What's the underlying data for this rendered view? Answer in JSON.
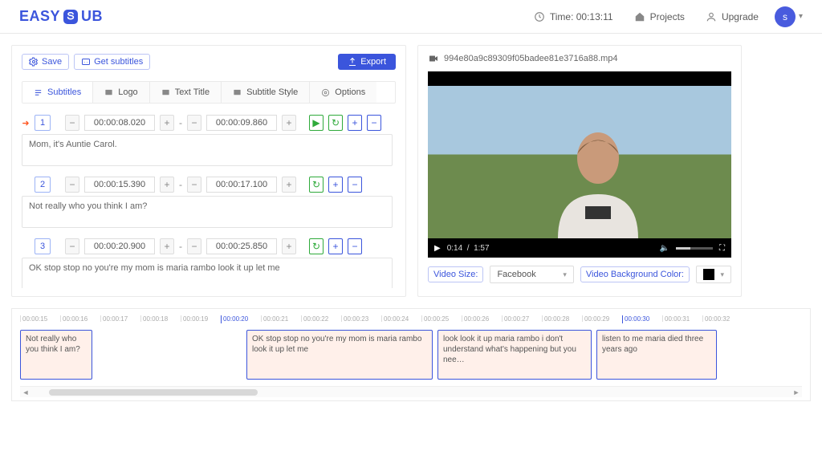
{
  "header": {
    "logo_prefix": "EASY",
    "logo_suffix": "UB",
    "time_label": "Time:",
    "time_value": "00:13:11",
    "projects": "Projects",
    "upgrade": "Upgrade",
    "avatar_letter": "s"
  },
  "toolbar": {
    "save": "Save",
    "get_subtitles": "Get subtitles",
    "export": "Export"
  },
  "tabs": {
    "subtitles": "Subtitles",
    "logo": "Logo",
    "text_title": "Text Title",
    "subtitle_style": "Subtitle Style",
    "options": "Options"
  },
  "subs": [
    {
      "n": "1",
      "start": "00:00:08.020",
      "end": "00:00:09.860",
      "text": "Mom, it's Auntie Carol.",
      "current": true
    },
    {
      "n": "2",
      "start": "00:00:15.390",
      "end": "00:00:17.100",
      "text": "Not really who you think I am?",
      "current": false
    },
    {
      "n": "3",
      "start": "00:00:20.900",
      "end": "00:00:25.850",
      "text": "OK stop stop no you're my mom is maria rambo look it up let me",
      "current": false
    }
  ],
  "video": {
    "filename": "994e80a9c89309f05badee81e3716a88.mp4",
    "cur_time": "0:14",
    "duration": "1:57"
  },
  "right_controls": {
    "video_size_label": "Video Size:",
    "video_size_value": "Facebook",
    "bg_color_label": "Video Background Color:"
  },
  "timeline": {
    "ticks": [
      "00:00:15",
      "00:00:16",
      "00:00:17",
      "00:00:18",
      "00:00:19",
      "00:00:20",
      "00:00:21",
      "00:00:22",
      "00:00:23",
      "00:00:24",
      "00:00:25",
      "00:00:26",
      "00:00:27",
      "00:00:28",
      "00:00:29",
      "00:00:30",
      "00:00:31",
      "00:00:32"
    ],
    "major_ticks": [
      "00:00:20",
      "00:00:30"
    ],
    "clips": [
      "Not really who you think I am?",
      "OK stop stop no you're my mom is maria rambo look it up let me",
      "look look it up maria rambo i don't understand what's happening but you nee…",
      "listen to me maria died three years ago"
    ]
  }
}
